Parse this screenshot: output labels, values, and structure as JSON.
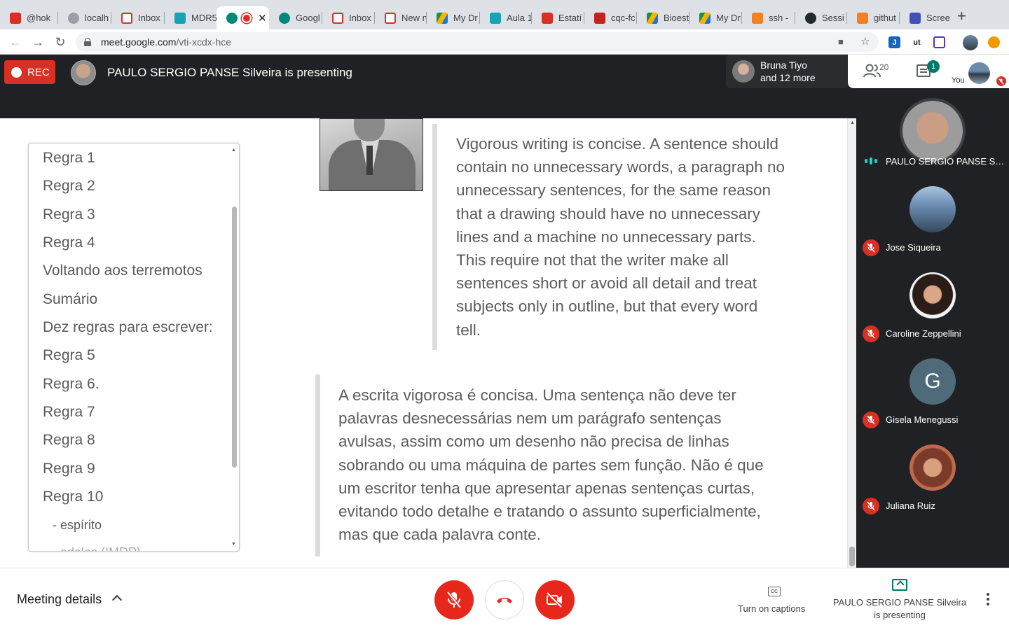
{
  "browser": {
    "tabs": [
      {
        "title": "@hok",
        "icon": "app-icon",
        "color": "#d93025"
      },
      {
        "title": "localh",
        "icon": "globe-icon",
        "color": "#9aa0a6"
      },
      {
        "title": "Inbox",
        "icon": "gmail-icon",
        "color": "#d93025"
      },
      {
        "title": "MDR5",
        "icon": "classroom-icon",
        "color": "#1aa1b5"
      },
      {
        "title": "",
        "icon": "meet-icon",
        "color": "#00897b",
        "active": true
      },
      {
        "title": "Googl",
        "icon": "meet-icon",
        "color": "#00897b"
      },
      {
        "title": "Inbox",
        "icon": "gmail-icon",
        "color": "#d93025"
      },
      {
        "title": "New n",
        "icon": "gmail-icon",
        "color": "#d93025"
      },
      {
        "title": "My Dr",
        "icon": "drive-icon",
        "color": "#f4b400"
      },
      {
        "title": "Aula 1",
        "icon": "classroom-icon",
        "color": "#1aa1b5"
      },
      {
        "title": "Estatí",
        "icon": "pdf-icon",
        "color": "#d93025"
      },
      {
        "title": "cqc-fc",
        "icon": "film-icon",
        "color": "#c5221f"
      },
      {
        "title": "Bioest",
        "icon": "drive-icon",
        "color": "#f4b400"
      },
      {
        "title": "My Dr",
        "icon": "drive-icon",
        "color": "#f4b400"
      },
      {
        "title": "ssh -",
        "icon": "stackoverflow-icon",
        "color": "#f48024"
      },
      {
        "title": "Sessi",
        "icon": "github-icon",
        "color": "#24292e"
      },
      {
        "title": "githut",
        "icon": "stackoverflow-icon",
        "color": "#f48024"
      },
      {
        "title": "Scree",
        "icon": "screencast-icon",
        "color": "#3f51b5"
      }
    ],
    "new_tab": "+",
    "close_tab": "✕",
    "url_host": "meet.google.com",
    "url_path": "/vti-xcdx-hce"
  },
  "meet": {
    "rec_label": "REC",
    "presenting_text": "PAULO SERGIO PANSE Silveira is presenting",
    "joiner_line1": "Bruna Tiyo",
    "joiner_line2": "and 12 more",
    "people_count": "20",
    "chat_badge": "1",
    "you_label": "You"
  },
  "screen": {
    "toc": [
      "Regra 1",
      "Regra 2",
      "Regra 3",
      "Regra 4",
      "Voltando aos terremotos",
      "Sumário",
      "Dez regras para escrever:",
      "Regra 5",
      "Regra 6.",
      "Regra 7",
      "Regra 8",
      "Regra 9",
      "Regra 10",
      "- espírito",
      "- adalas (IMDP)"
    ],
    "quote_en": "Vigorous writing is concise. A sentence should contain no unnecessary words, a paragraph no unnecessary sentences, for the same reason that a drawing should have no unnecessary lines and a machine no unnecessary parts. This require not that the writer make all sentences short or avoid all detail and treat subjects only in outline, but that every word tell.",
    "quote_pt": "A escrita vigorosa é concisa. Uma sentença não deve ter palavras desnecessárias nem um parágrafo sentenças avulsas, assim como um desenho não precisa de linhas sobrando ou uma máquina de partes sem função. Não é que um escritor tenha que apresentar apenas sentenças curtas, evitando todo detalhe e tratando o assunto superficialmente, mas que cada palavra conte."
  },
  "participants": [
    {
      "name": "PAULO SERGIO PANSE Silveira",
      "speaking": true
    },
    {
      "name": "Jose Siqueira",
      "muted": true
    },
    {
      "name": "Caroline Zeppellini",
      "muted": true
    },
    {
      "name": "Gisela Menegussi",
      "muted": true,
      "initial": "G"
    },
    {
      "name": "Juliana Ruiz",
      "muted": true
    }
  ],
  "bottom": {
    "meeting_details": "Meeting details",
    "captions_icon_text": "CC",
    "captions_label": "Turn on captions",
    "present_label": "PAULO SERGIO PANSE Silveira is presenting"
  },
  "colors": {
    "accent_red": "#d93025",
    "meet_teal": "#00796b",
    "dark_bg": "#202124"
  }
}
